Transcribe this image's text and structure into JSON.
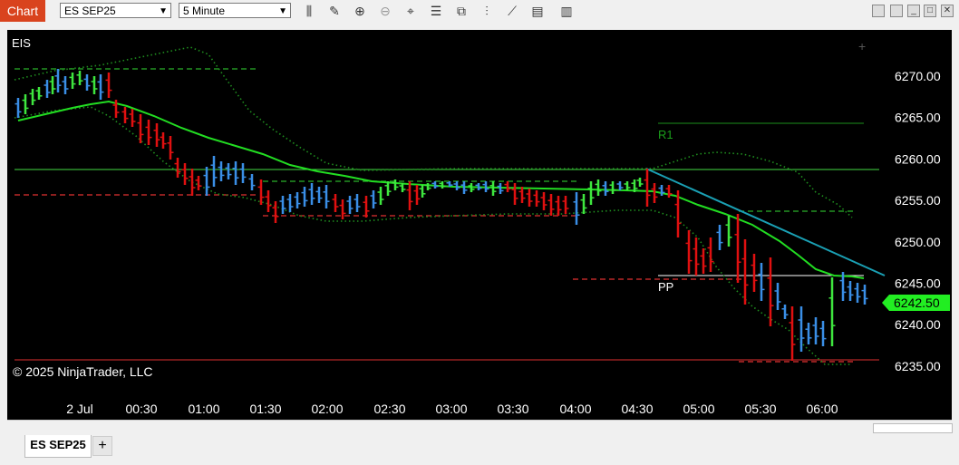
{
  "toolbar": {
    "chart_label": "Chart",
    "instrument": "ES SEP25",
    "interval": "5 Minute"
  },
  "chart": {
    "instrument_label": "EIS",
    "copyright": "© 2025 NinjaTrader, LLC",
    "price_ticks": [
      "6270.00",
      "6265.00",
      "6260.00",
      "6255.00",
      "6250.00",
      "6245.00",
      "6240.00",
      "6235.00"
    ],
    "time_ticks": [
      "2 Jul",
      "00:30",
      "01:00",
      "01:30",
      "02:00",
      "02:30",
      "03:00",
      "03:30",
      "04:00",
      "04:30",
      "05:00",
      "05:30",
      "06:00"
    ],
    "current_price": "6242.50",
    "level_r1": "R1",
    "level_pp": "PP",
    "colors": {
      "up": "#3ee63e",
      "down": "#e01010",
      "neutral": "#3a8ee6",
      "ema": "#22dd22",
      "trend": "#1aa0b4",
      "price_marker": "#22ee22"
    }
  },
  "tabs": {
    "active": "ES SEP25",
    "add": "+"
  }
}
